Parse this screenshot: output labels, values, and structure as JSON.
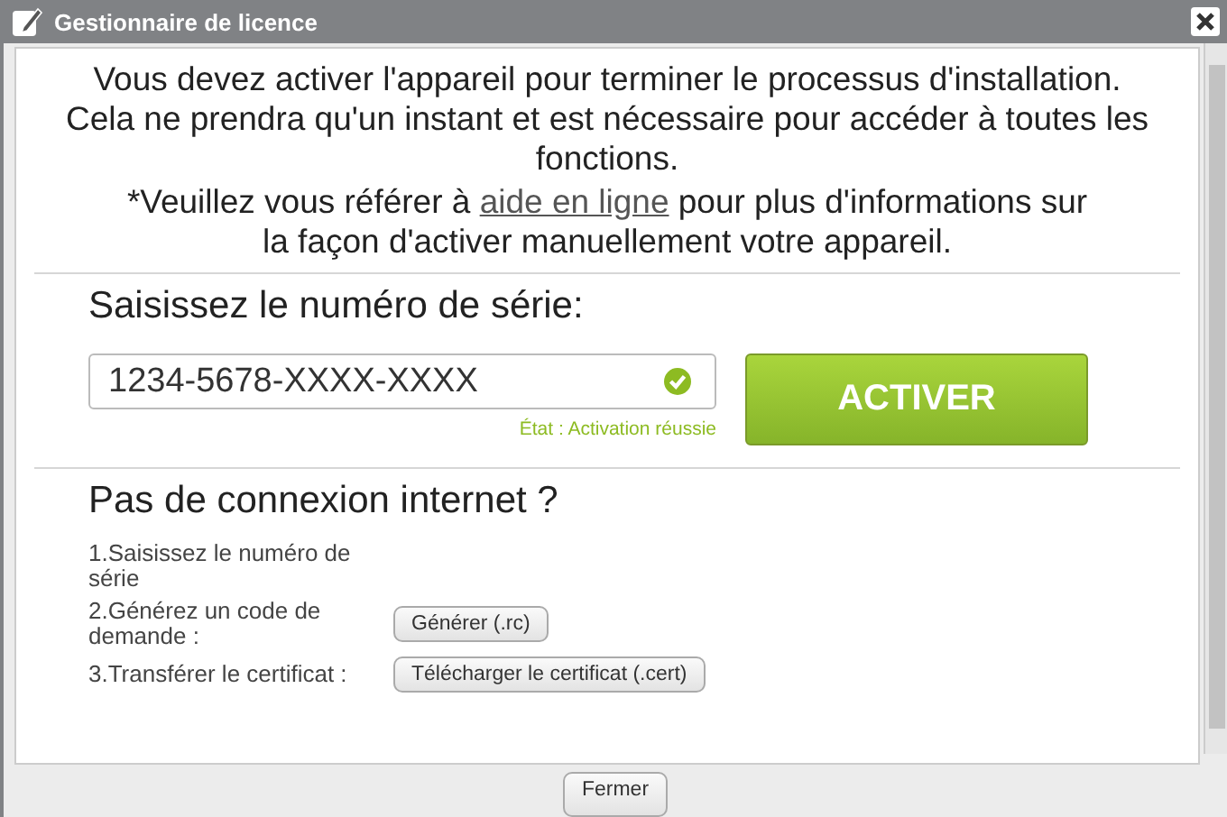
{
  "window": {
    "title": "Gestionnaire de licence"
  },
  "intro": {
    "text": "Vous devez activer l'appareil pour terminer le processus d'installation.",
    "text2": "Cela ne prendra qu'un instant et est nécessaire pour accéder à toutes les fonctions.",
    "help_before": "*Veuillez vous référer à",
    "help_link": "aide en ligne",
    "help_after": "pour plus d'informations sur la façon d'activer manuellement votre appareil."
  },
  "serial": {
    "heading": "Saisissez le numéro de série:",
    "value": "1234-5678-XXXX-XXXX",
    "valid": true,
    "status": "État : Activation réussie",
    "button": "ACTIVER"
  },
  "offline": {
    "heading": "Pas de connexion internet ?",
    "steps": [
      {
        "label": "1.Saisissez le numéro de série"
      },
      {
        "label": "2.Générez un code de demande :",
        "button": "Générer (.rc)"
      },
      {
        "label": "3.Transférer le certificat :",
        "button": "Télécharger le certificat (.cert)"
      }
    ]
  },
  "footer": {
    "button": "Fermer"
  }
}
